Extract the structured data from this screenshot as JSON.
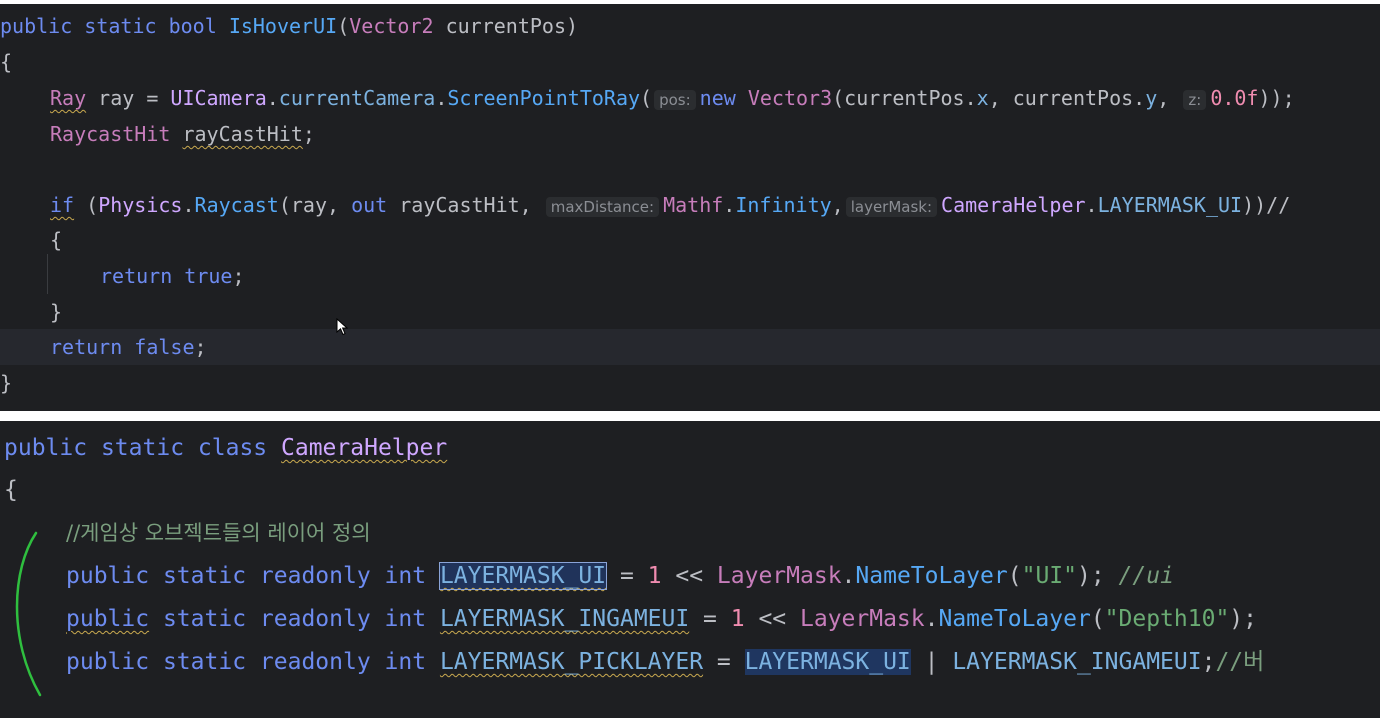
{
  "top_code": {
    "l1": {
      "kw1": "public",
      "kw2": "static",
      "kw3": "bool",
      "method": "IsHoverUI",
      "paren": "(",
      "type": "Vector2",
      "rest": " currentPos)"
    },
    "l2": "{",
    "l3": {
      "type": "Ray",
      "v": " ray = ",
      "cls": "UICamera",
      "dot1": ".",
      "field": "currentCamera",
      "dot2": ".",
      "method": "ScreenPointToRay",
      "p": "(",
      "hint_pos": "pos:",
      "kw_new": "new",
      "type2": "Vector3",
      "a": "(currentPos.",
      "x": "x",
      "b": ", currentPos.",
      "y": "y",
      "c": ",",
      "hint_z": "z:",
      "num": "0.0f",
      "end": "));"
    },
    "l4": {
      "type": "RaycastHit",
      "sp": " ",
      "var": "rayCastHit",
      "end": ";"
    },
    "l6": {
      "kw_if": "if",
      "p": " (",
      "cls": "Physics",
      "dot": ".",
      "method": "Raycast",
      "a": "(ray, ",
      "kw_out": "out",
      "b": " rayCastHit, ",
      "hint_max": "maxDistance:",
      "type": "Mathf",
      "dot2": ".",
      "field": "Infinity",
      "c": ",",
      "hint_layer": "layerMask:",
      "cls2": "CameraHelper",
      "dot3": ".",
      "field2": "LAYERMASK_UI",
      "end": "))//"
    },
    "l7": "{",
    "l8": {
      "kw_return": "return",
      "sp": " ",
      "kw_true": "true",
      "end": ";"
    },
    "l9": "}",
    "l10": {
      "kw_return": "return",
      "sp": " ",
      "kw_false": "false",
      "end": ";"
    },
    "l11": "}"
  },
  "bottom_code": {
    "l1": {
      "kw1": "public",
      "kw2": "static",
      "kw3": "class",
      "cls": "CameraHelper"
    },
    "l2": "{",
    "l3": "//게임상 오브젝트들의 레이어 정의",
    "l4": {
      "kw1": "public",
      "kw2": "static",
      "kw3": "readonly",
      "kw4": "int",
      "name": "LAYERMASK_UI",
      "eq": " = ",
      "one": "1",
      "shift": " << ",
      "cls": "LayerMask",
      "dot": ".",
      "method": "NameToLayer",
      "p1": "(",
      "str": "\"UI\"",
      "p2": "); ",
      "cmt": "//ui"
    },
    "l5": {
      "kw1": "public",
      "kw2": "static",
      "kw3": "readonly",
      "kw4": "int",
      "name": "LAYERMASK_INGAMEUI",
      "eq": " = ",
      "one": "1",
      "shift": " << ",
      "cls": "LayerMask",
      "dot": ".",
      "method": "NameToLayer",
      "p1": "(",
      "str": "\"Depth10\"",
      "p2": ");"
    },
    "l6": {
      "kw1": "public",
      "kw2": "static",
      "kw3": "readonly",
      "kw4": "int",
      "name": "LAYERMASK_PICKLAYER",
      "eq": " = ",
      "ref1": "LAYERMASK_UI",
      "bar": " | ",
      "ref2": "LAYERMASK_INGAMEUI",
      "end": ";",
      "cmt": "//버"
    }
  },
  "colors": {
    "editor_bg": "#1e1f22",
    "keyword": "#6d8bf0",
    "method": "#56a8f5",
    "type": "#c77dbb",
    "string": "#6aab73",
    "number": "#f08cb0",
    "annotation": "#2fbf3f"
  },
  "icons": {
    "cursor": "mouse-pointer-icon",
    "annotation": "green-bracket-annotation"
  }
}
